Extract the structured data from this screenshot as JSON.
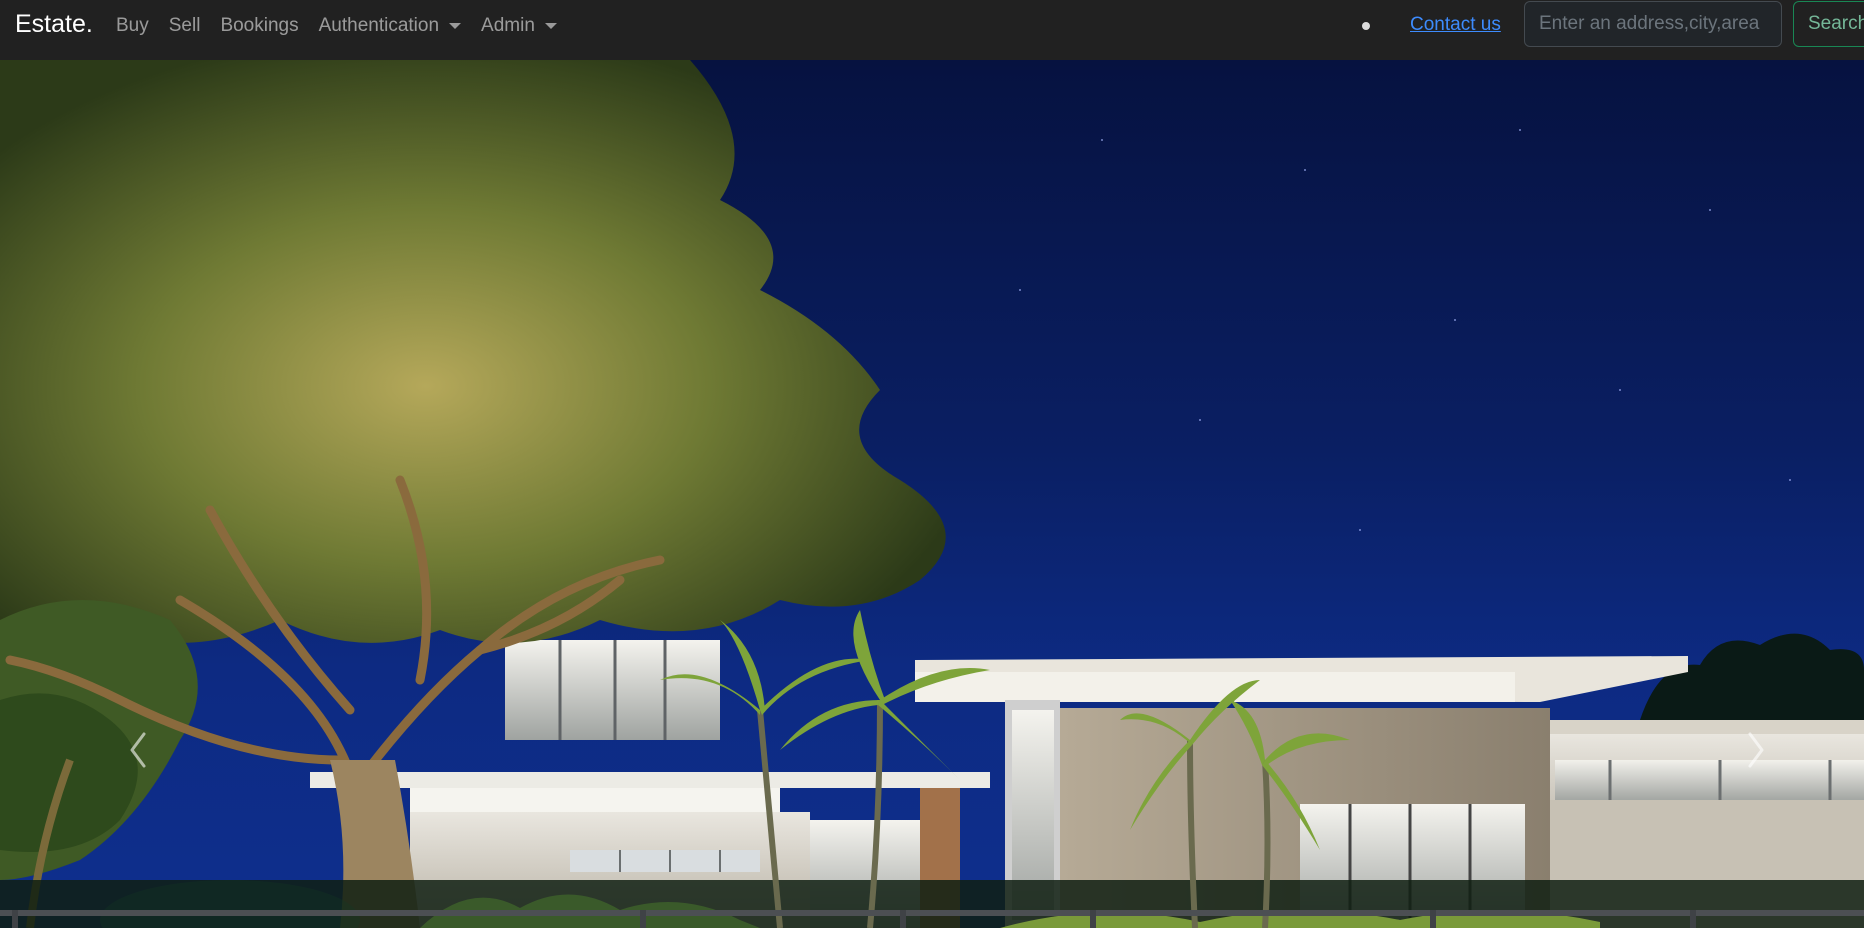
{
  "navbar": {
    "brand": "Estate.",
    "links": [
      {
        "label": "Buy"
      },
      {
        "label": "Sell"
      },
      {
        "label": "Bookings"
      }
    ],
    "dropdowns": [
      {
        "label": "Authentication"
      },
      {
        "label": "Admin"
      }
    ],
    "contact_label": "Contact us",
    "search": {
      "placeholder": "Enter an address,city,area",
      "button_label": "Search"
    }
  },
  "carousel": {
    "prev_icon": "chevron-left-icon",
    "next_icon": "chevron-right-icon"
  },
  "colors": {
    "navbar_bg": "#212121",
    "contact_link": "#3d8bfd",
    "search_button_border": "#198754",
    "search_button_text": "#75b798"
  }
}
